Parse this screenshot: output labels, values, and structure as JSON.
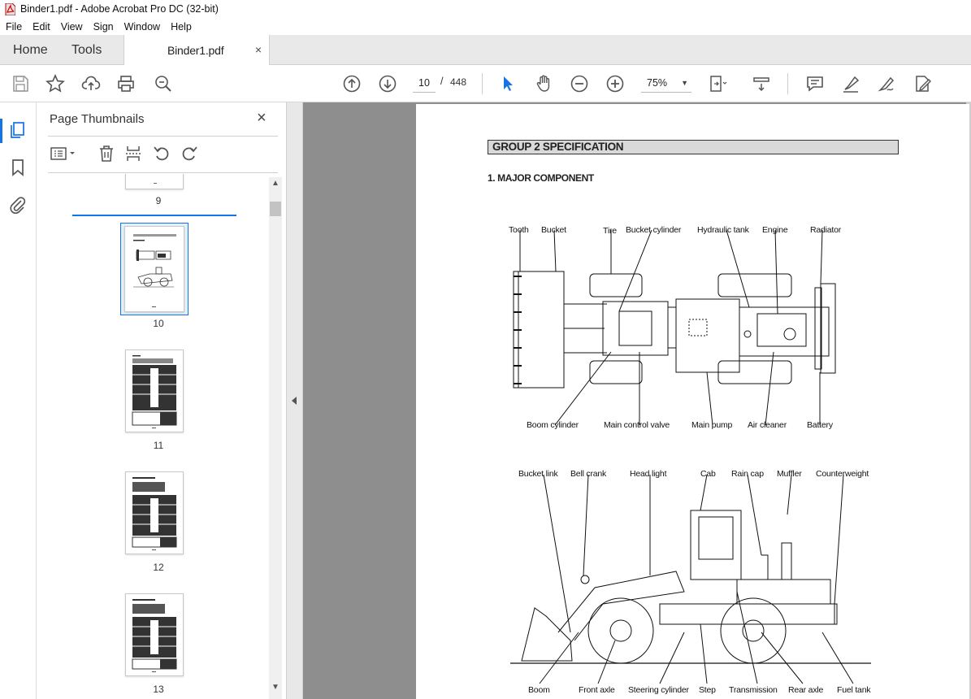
{
  "window": {
    "title": "Binder1.pdf - Adobe Acrobat Pro DC (32-bit)"
  },
  "menu": [
    "File",
    "Edit",
    "View",
    "Sign",
    "Window",
    "Help"
  ],
  "tabs": {
    "home": "Home",
    "tools": "Tools",
    "document": "Binder1.pdf",
    "close": "×"
  },
  "toolbar": {
    "page_current": "10",
    "page_separator": "/",
    "page_total": "448",
    "zoom": "75%"
  },
  "icons": {
    "save": "save-icon",
    "bookmark_star": "star-icon",
    "upload": "cloud-upload-icon",
    "print": "print-icon",
    "find": "search-zoom-icon",
    "prev": "arrow-up-icon",
    "next": "arrow-down-icon",
    "select": "cursor-icon",
    "hand": "hand-icon",
    "zoom_out": "minus-circle-icon",
    "zoom_in": "plus-circle-icon",
    "fit": "fit-page-icon",
    "scroll_mode": "scroll-mode-icon",
    "comment": "comment-icon",
    "highlight": "highlighter-icon",
    "sign": "sign-icon",
    "fill_sign": "fill-sign-icon"
  },
  "thumbnails_panel": {
    "title": "Page Thumbnails",
    "close": "×",
    "pages": [
      {
        "label": "9",
        "selected": false
      },
      {
        "label": "10",
        "selected": true
      },
      {
        "label": "11",
        "selected": false
      },
      {
        "label": "12",
        "selected": false
      },
      {
        "label": "13",
        "selected": false
      }
    ]
  },
  "document": {
    "group_heading": "GROUP  2  SPECIFICATION",
    "section_heading": "1. MAJOR COMPONENT",
    "top_view_labels_top": [
      "Tooth",
      "Bucket",
      "Tire",
      "Bucket cylinder",
      "Hydraulic tank",
      "Engine",
      "Radiator"
    ],
    "top_view_labels_bottom": [
      "Boom cylinder",
      "Main control valve",
      "Main pump",
      "Air cleaner",
      "Battery"
    ],
    "side_view_labels_top": [
      "Bucket link",
      "Bell crank",
      "Head light",
      "Cab",
      "Rain cap",
      "Muffler",
      "Counterweight"
    ],
    "side_view_labels_bottom": [
      "Boom",
      "Front axle",
      "Steering cylinder",
      "Step",
      "Transmission",
      "Rear axle",
      "Fuel tank"
    ]
  },
  "colors": {
    "accent": "#1473e6",
    "viewer_bg": "#8e8e8e",
    "heading_bg": "#d9d9d9"
  }
}
